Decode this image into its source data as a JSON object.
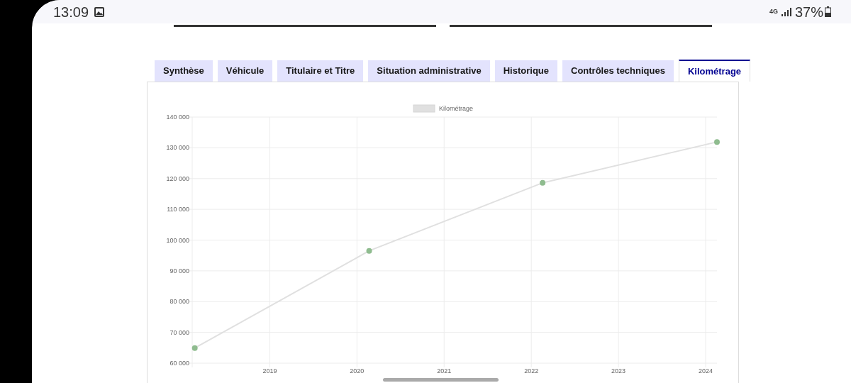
{
  "status_bar": {
    "time": "13:09",
    "network": "4G",
    "battery": "37%"
  },
  "tabs": [
    {
      "label": "Synthèse",
      "selected": false
    },
    {
      "label": "Véhicule",
      "selected": false
    },
    {
      "label": "Titulaire et Titre",
      "selected": false
    },
    {
      "label": "Situation administrative",
      "selected": false
    },
    {
      "label": "Historique",
      "selected": false
    },
    {
      "label": "Contrôles techniques",
      "selected": false
    },
    {
      "label": "Kilométrage",
      "selected": true
    }
  ],
  "chart_data": {
    "type": "line",
    "grid": true,
    "xlim": [
      2018.11,
      2024.13
    ],
    "ylim": [
      60000,
      140000
    ],
    "xticks": [
      2019,
      2020,
      2021,
      2022,
      2023,
      2024
    ],
    "yticks": [
      {
        "value": 60000,
        "label": "60 000"
      },
      {
        "value": 70000,
        "label": "70 000"
      },
      {
        "value": 80000,
        "label": "80 000"
      },
      {
        "value": 90000,
        "label": "90 000"
      },
      {
        "value": 100000,
        "label": "100 000"
      },
      {
        "value": 110000,
        "label": "110 000"
      },
      {
        "value": 120000,
        "label": "120 000"
      },
      {
        "value": 130000,
        "label": "130 000"
      },
      {
        "value": 140000,
        "label": "140 000"
      }
    ],
    "x": [
      2018.14,
      2020.14,
      2022.13,
      2024.13
    ],
    "series": [
      {
        "name": "Kilométrage",
        "marker": true,
        "color": "#e0e0e0",
        "values": [
          64900,
          96500,
          118600,
          131900
        ]
      }
    ]
  }
}
